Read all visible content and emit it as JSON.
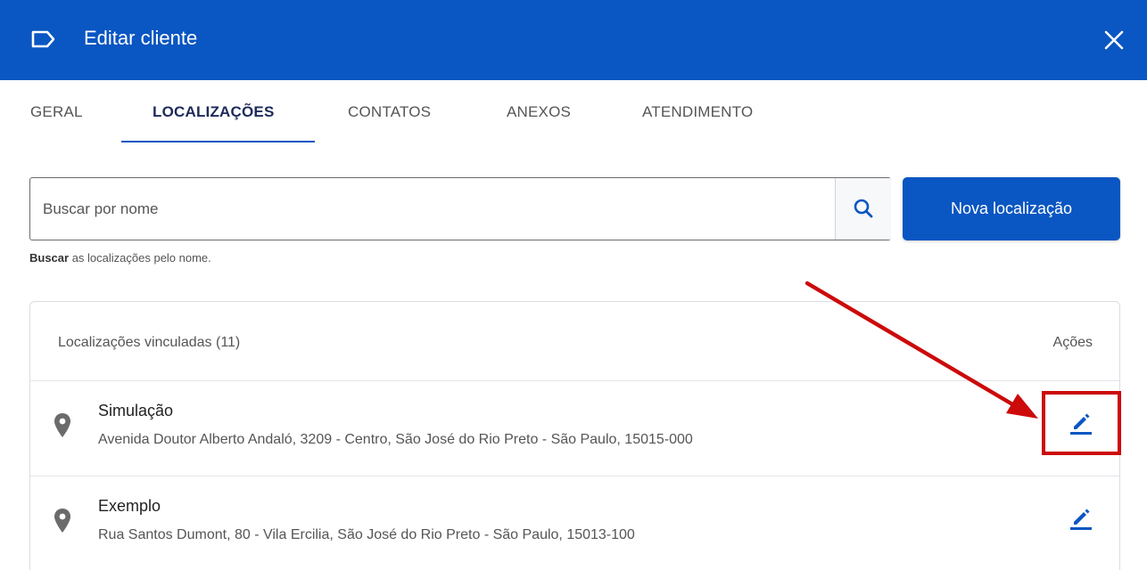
{
  "header": {
    "title": "Editar cliente",
    "icon": "label-icon",
    "close_icon": "close-icon",
    "color": "#0a56c2"
  },
  "tabs": [
    {
      "label": "GERAL",
      "active": false
    },
    {
      "label": "LOCALIZAÇÕES",
      "active": true
    },
    {
      "label": "CONTATOS",
      "active": false
    },
    {
      "label": "ANEXOS",
      "active": false
    },
    {
      "label": "ATENDIMENTO",
      "active": false
    }
  ],
  "search": {
    "placeholder": "Buscar por nome",
    "value": "",
    "icon": "search-icon",
    "helper_bold": "Buscar",
    "helper_text": " as localizações pelo nome."
  },
  "new_location_button": "Nova localização",
  "locations_card": {
    "title": "Localizações vinculadas (11)",
    "actions_label": "Ações",
    "rows": [
      {
        "name": "Simulação",
        "address": "Avenida Doutor Alberto Andaló, 3209 - Centro, São José do Rio Preto - São Paulo, 15015-000",
        "icon": "location-pin-icon",
        "action_icon": "edit-icon"
      },
      {
        "name": "Exemplo",
        "address": "Rua Santos Dumont, 80 - Vila Ercilia, São José do Rio Preto - São Paulo, 15013-100",
        "icon": "location-pin-icon",
        "action_icon": "edit-icon"
      }
    ]
  },
  "annotation": {
    "color": "#cc0a0a",
    "arrow_icon": "arrow-annotation",
    "highlight": "highlight-box"
  }
}
